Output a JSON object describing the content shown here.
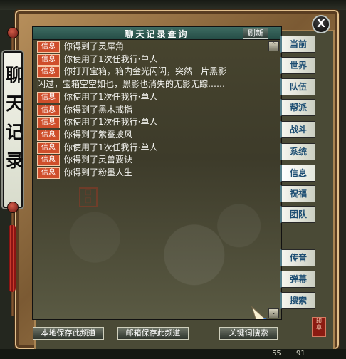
{
  "window": {
    "title": "聊天记录查询",
    "side_title": "聊天记录",
    "refresh": "刷新",
    "close": "X"
  },
  "messages": [
    {
      "tag": "信息",
      "text": "你得到了灵犀角"
    },
    {
      "tag": "信息",
      "text": "你使用了1次任我行·单人"
    },
    {
      "tag": "信息",
      "text": "你打开宝箱，箱内金光闪闪，突然一片黑影",
      "continuation": "闪过，宝箱空空如也，黑影也消失的无影无踪……"
    },
    {
      "tag": "信息",
      "text": "你使用了1次任我行·单人"
    },
    {
      "tag": "信息",
      "text": "你得到了黑木戒指"
    },
    {
      "tag": "信息",
      "text": "你使用了1次任我行·单人"
    },
    {
      "tag": "信息",
      "text": "你得到了紫蚕披风"
    },
    {
      "tag": "信息",
      "text": "你使用了1次任我行·单人"
    },
    {
      "tag": "信息",
      "text": "你得到了灵兽要诀"
    },
    {
      "tag": "信息",
      "text": "你得到了粉墨人生"
    }
  ],
  "side_tabs": [
    "当前",
    "世界",
    "队伍",
    "帮派",
    "战斗",
    "系统",
    "信息",
    "祝福",
    "团队",
    "传音",
    "弹幕",
    "搜索"
  ],
  "bottom_buttons": [
    "本地保存此频道",
    "邮箱保存此频道",
    "关键词搜索"
  ],
  "status": {
    "left_value": "55",
    "right_value": "91"
  },
  "colors": {
    "accent": "#cf4e2b",
    "header": "#2f5b54",
    "panel": "#4a4a36"
  }
}
